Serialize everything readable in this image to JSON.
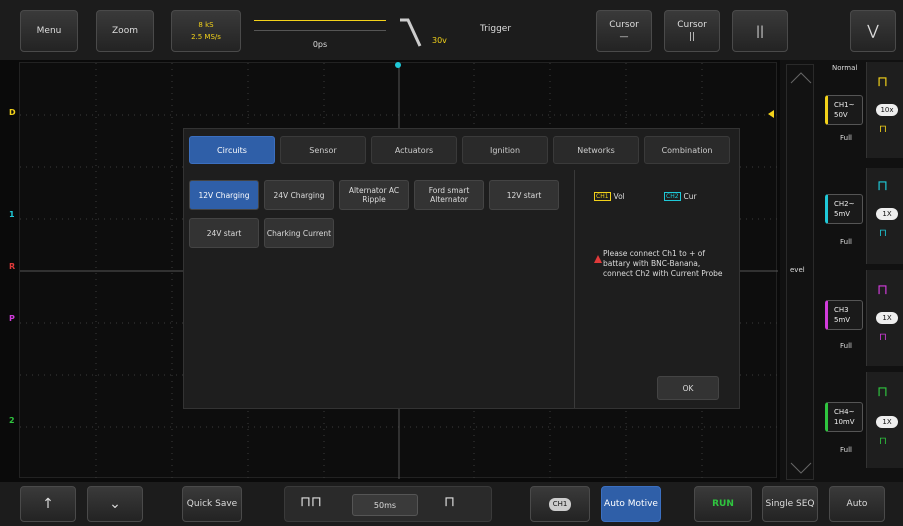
{
  "topbar": {
    "menu": "Menu",
    "zoom": "Zoom",
    "sample_line1": "8 kS",
    "sample_line2": "2.5 MS/s",
    "time_offset": "0ps",
    "trigger_level": "30v",
    "trigger_label": "Trigger",
    "cursor1_label": "Cursor",
    "cursor1_sub": "—",
    "cursor2_label": "Cursor",
    "cursor2_sub": "||",
    "pause_icon": "||",
    "collapse_icon": "chevron-down"
  },
  "modal": {
    "tabs": [
      "Circuits",
      "Sensor",
      "Actuators",
      "Ignition",
      "Networks",
      "Combination"
    ],
    "active_tab": "Circuits",
    "circuits": [
      {
        "label": "12V Charging",
        "active": true
      },
      {
        "label": "24V Charging",
        "active": false
      },
      {
        "label": "Alternator AC Ripple",
        "active": false
      },
      {
        "label": "Ford smart Alternator",
        "active": false
      },
      {
        "label": "12V start",
        "active": false
      },
      {
        "label": "24V start",
        "active": false
      },
      {
        "label": "Charking Current",
        "active": false
      }
    ],
    "legend_ch1": "CH1",
    "legend_ch1_text": "Vol",
    "legend_ch2": "CH2",
    "legend_ch2_text": "Cur",
    "instruction": "Please connect Ch1 to + of battary with BNC-Banana, connect Ch2 with Current Probe",
    "ok": "OK"
  },
  "right_panel": {
    "mode": "Normal",
    "level_label": "evel",
    "channels": [
      {
        "name": "CH1~",
        "scale": "50V",
        "mode": "Full",
        "probe": "10x",
        "color": "#f3d21a"
      },
      {
        "name": "CH2~",
        "scale": "5mV",
        "mode": "Full",
        "probe": "1X",
        "color": "#1fc9d8"
      },
      {
        "name": "CH3",
        "scale": "5mV",
        "mode": "Full",
        "probe": "1X",
        "color": "#d23cdc"
      },
      {
        "name": "CH4~",
        "scale": "10mV",
        "mode": "Full",
        "probe": "1X",
        "color": "#2fc53f"
      }
    ]
  },
  "markers": {
    "ch1": "D",
    "ch2": "1",
    "ch3": "R",
    "ch4": "P",
    "ch5": "2"
  },
  "bottombar": {
    "up": "↑",
    "down": "⌄",
    "quick_save": "Quick Save",
    "timebase": "50ms",
    "ch_toggle": "CH1",
    "automotive": "Auto Motive",
    "run": "RUN",
    "single_seq": "Single SEQ",
    "auto": "Auto"
  },
  "colors": {
    "accent": "#2f5fa8",
    "run": "#2fc53f",
    "ch1": "#f3d21a",
    "ch2": "#1fc9d8",
    "ch3": "#d23cdc",
    "ch4": "#2fc53f",
    "warning": "#e03a3a"
  }
}
